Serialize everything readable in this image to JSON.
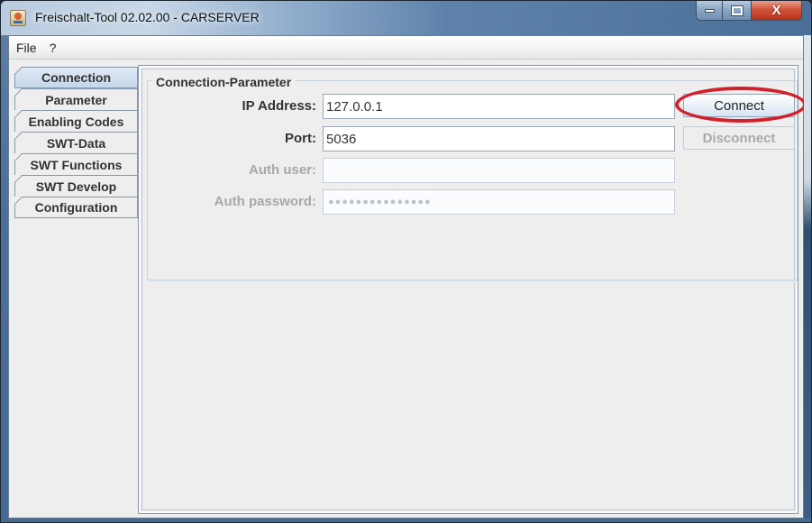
{
  "window": {
    "title": "Freischalt-Tool 02.02.00 - CARSERVER",
    "controls": {
      "minimize": "minimize-icon",
      "maximize": "maximize-icon",
      "close": "close-icon",
      "close_glyph": "X"
    }
  },
  "menubar": {
    "items": [
      {
        "label": "File"
      },
      {
        "label": "?"
      }
    ]
  },
  "tabs": {
    "items": [
      {
        "label": "Connection",
        "active": true
      },
      {
        "label": "Parameter",
        "active": false
      },
      {
        "label": "Enabling Codes",
        "active": false
      },
      {
        "label": "SWT-Data",
        "active": false
      },
      {
        "label": "SWT Functions",
        "active": false
      },
      {
        "label": "SWT Develop",
        "active": false
      },
      {
        "label": "Configuration",
        "active": false
      }
    ]
  },
  "connection": {
    "group_title": "Connection-Parameter",
    "ip": {
      "label": "IP Address:",
      "value": "127.0.0.1"
    },
    "port": {
      "label": "Port:",
      "value": "5036"
    },
    "auth_user": {
      "label": "Auth user:",
      "value": "",
      "enabled": false
    },
    "auth_password": {
      "label": "Auth password:",
      "masked_value": "●●●●●●●●●●●●●●●",
      "length": 15,
      "enabled": false
    },
    "connect_button": {
      "label": "Connect",
      "enabled": true,
      "highlighted": true
    },
    "disconnect_button": {
      "label": "Disconnect",
      "enabled": false
    }
  },
  "colors": {
    "highlight": "#d3202a",
    "active_tab": "#c4d6ea",
    "disabled_text": "#a8a8a8"
  }
}
